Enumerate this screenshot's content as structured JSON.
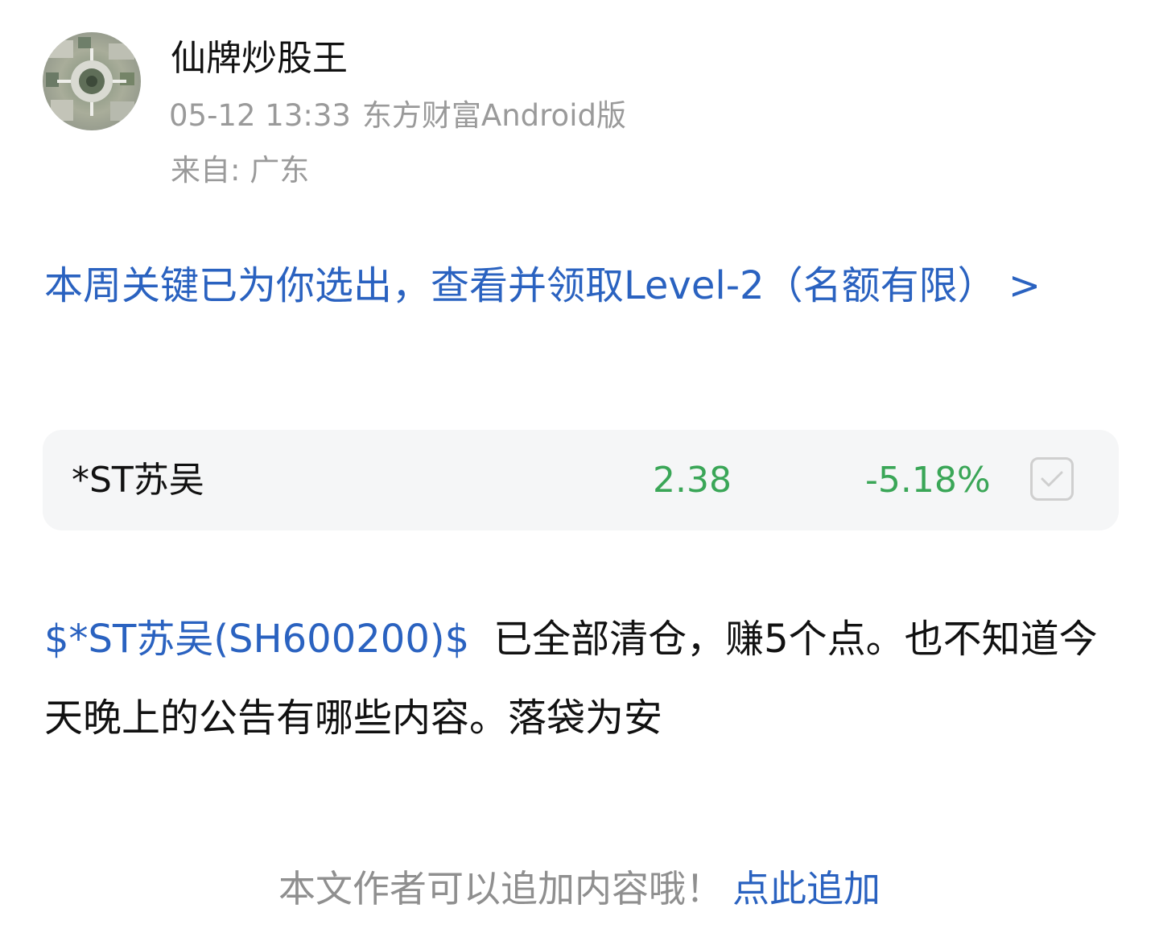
{
  "post": {
    "author": {
      "name": "仙牌炒股王"
    },
    "timestamp": "05-12 13:33",
    "source": "东方财富Android版",
    "location": "来自: 广东"
  },
  "promo": {
    "text": "本周关键已为你选出，查看并领取Level-2（名额有限） >"
  },
  "stock_card": {
    "name": "*ST苏吴",
    "price": "2.38",
    "change": "-5.18%",
    "price_color": "#3aa657"
  },
  "body": {
    "stock_link": "$*ST苏吴(SH600200)$",
    "text": "已全部清仓，赚5个点。也不知道今天晚上的公告有哪些内容。落袋为安"
  },
  "footer": {
    "hint": "本文作者可以追加内容哦！",
    "action": "点此追加"
  },
  "colors": {
    "link": "#2a62c0",
    "down": "#3aa657",
    "muted": "#9a9a9a"
  }
}
